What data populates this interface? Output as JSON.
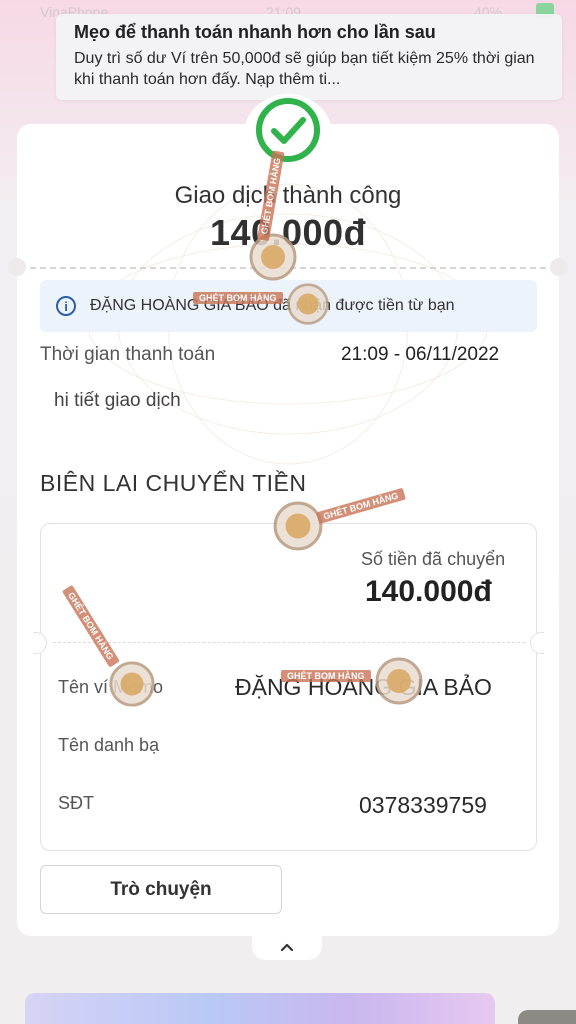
{
  "status_bar": {
    "carrier": "VinaPhone",
    "time": "21:09",
    "battery": "40%"
  },
  "toast": {
    "title": "Mẹo để thanh toán nhanh hơn cho lần sau",
    "body": "Duy trì số dư Ví trên 50,000đ sẽ giúp bạn tiết kiệm 25% thời gian khi thanh toán hơn đấy. Nạp thêm ti..."
  },
  "transaction": {
    "status": "Giao dịch thành công",
    "amount": "140.000đ",
    "notice": "ĐẶNG HOÀNG GIA BẢO đã nhận được tiền từ bạn",
    "time_label": "Thời gian thanh toán",
    "time_value": "21:09 - 06/11/2022",
    "details_label": "hi tiết giao dịch"
  },
  "receipt": {
    "title": "BIÊN LAI CHUYỂN TIỀN",
    "amount_label": "Số tiền đã chuyển",
    "amount_value": "140.000đ",
    "rows": [
      {
        "label": "Tên ví Momo",
        "value": "ĐẶNG HOÀNG GIA BẢO"
      },
      {
        "label": "Tên danh bạ",
        "value": ""
      },
      {
        "label": "SĐT",
        "value": "0378339759"
      }
    ]
  },
  "actions": {
    "chat_button": "Trò chuyện"
  },
  "watermark": {
    "text": "GHÉT BOM HÀNG"
  },
  "colors": {
    "success": "#2fb34a",
    "info_bg": "#edf3fb",
    "info_icon": "#2c5fa9"
  },
  "icons": [
    "check-circle-icon",
    "info-icon",
    "chevron-up-icon"
  ]
}
